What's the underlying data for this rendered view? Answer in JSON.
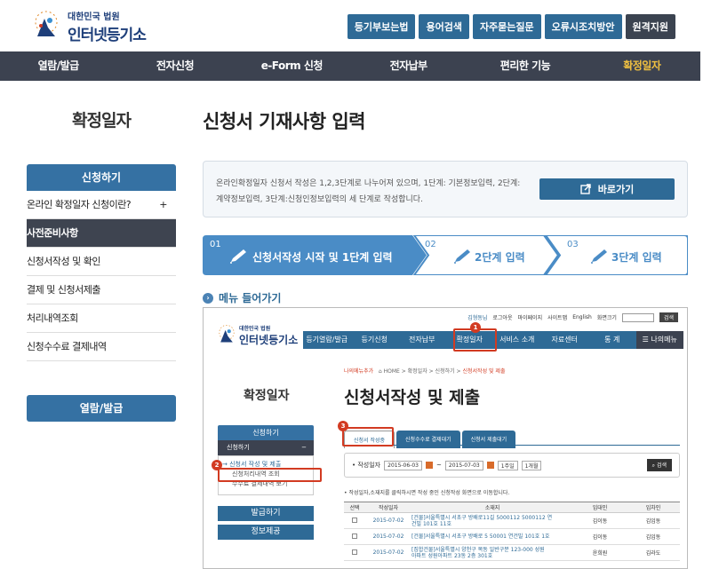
{
  "header": {
    "logo_sub": "대한민국 법원",
    "logo_main": "인터넷등기소",
    "top_buttons": [
      "등기부보는법",
      "용어검색",
      "자주묻는질문",
      "오류시조치방안",
      "원격지원"
    ]
  },
  "gnb": [
    "열람/발급",
    "전자신청",
    "e-Form 신청",
    "전자납부",
    "편리한 기능",
    "확정일자"
  ],
  "lnb": {
    "title": "확정일자",
    "head": "신청하기",
    "items": [
      "온라인 확정일자 신청이란?",
      "사전준비사항",
      "신청서작성 및 확인",
      "결제 및 신청서제출",
      "처리내역조회",
      "신청수수료 결제내역"
    ],
    "plus": "+",
    "bottom_button": "열람/발급"
  },
  "main": {
    "title": "신청서 기재사항 입력",
    "info": "온라인확정일자 신청서 작성은 1,2,3단계로 나누어져 있으며, 1단계: 기본정보입력, 2단계:계약정보입력, 3단계:신청인정보입력의 세 단계로 작성합니다.",
    "go_button": "바로가기",
    "steps": [
      {
        "num": "01",
        "label": "신청서작성 시작 및 1단계 입력"
      },
      {
        "num": "02",
        "label": "2단계 입력"
      },
      {
        "num": "03",
        "label": "3단계 입력"
      }
    ],
    "section": "메뉴 들어가기"
  },
  "shot": {
    "util": [
      "김형동님",
      "로그아웃",
      "마이페이지",
      "사이트맵",
      "English",
      "화면크기"
    ],
    "util_search": "검색",
    "logo_sub": "대한민국 법원",
    "logo_main": "인터넷등기소",
    "gnb": [
      "등기열람/발급",
      "등기신청",
      "전자납부",
      "확정일자",
      "서비스 소개",
      "자료센터",
      "통 계",
      "나의메뉴"
    ],
    "breadcrumb_link": "나의메뉴추가",
    "breadcrumb": "HOME > 확정일자 > 신청하기 > ",
    "breadcrumb_cur": "신청서작성 및 제출",
    "lnb_title": "확정일자",
    "title": "신청서작성 및 제출",
    "lnb_head": "신청하기",
    "lnb_item": "신청하기",
    "lnb_minus": "−",
    "lnb_subs": [
      "→ 신청서 작성 및 제출",
      "신청처리내역 조회",
      "수수료 결제내역 보기"
    ],
    "lnb_btn1": "발급하기",
    "lnb_btn2": "정보제공",
    "tabs": [
      "신청서 작성중",
      "신청수수료 결제대기",
      "신청서 제출대기"
    ],
    "filter_label": "• 작성일자",
    "date_from": "2015-06-03",
    "date_sep": "~",
    "date_to": "2015-07-03",
    "quick": [
      "1주일",
      "1개월"
    ],
    "find": "검색",
    "note": "• 작성일자,소재지를 클릭하시면 작성 중인 신청작성 화면으로 이동합니다.",
    "table_headers": [
      "선택",
      "작성일자",
      "소재지",
      "임대인",
      "임차인"
    ],
    "rows": [
      {
        "date": "2015-07-02",
        "addr1": "[건물]서울특별시 서초구 방배로11길 5000112 5000112 연",
        "addr2": "건빌 101호 11호",
        "lessor": "김이동",
        "lessee": "김임동"
      },
      {
        "date": "2015-07-02",
        "addr1": "[건물]서울특별시 서초구 방배로 5 50001 연건빌 101호 1호",
        "addr2": "",
        "lessor": "김이동",
        "lessee": "김임동"
      },
      {
        "date": "2015-07-02",
        "addr1": "[집합건물]서울특별시 양천구 목동 일반구분 123-000 성원",
        "addr2": "아파트 성원아파트 23동 2층 301호",
        "lessor": "윤희원",
        "lessee": "김라도"
      }
    ],
    "badges": [
      "1",
      "2",
      "3"
    ]
  }
}
